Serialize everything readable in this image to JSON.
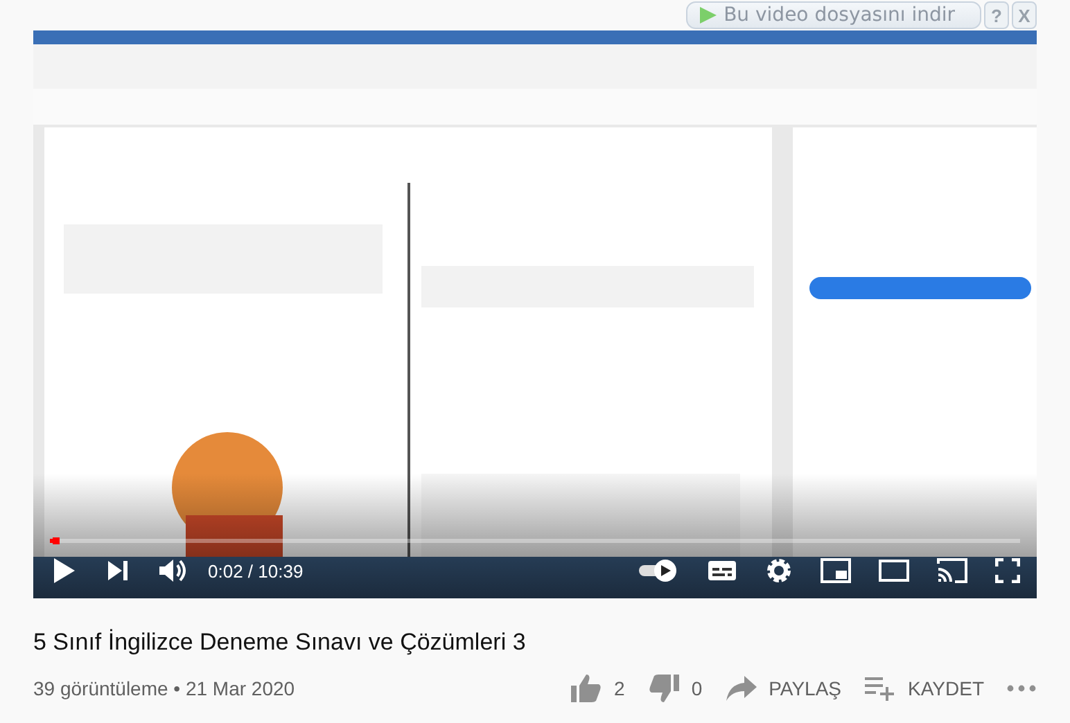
{
  "extension_bar": {
    "download_button": "Bu video dosyasını indir",
    "help": "?",
    "close": "X"
  },
  "player": {
    "progress": {
      "level": 0.003
    },
    "time": "0:02 / 10:39",
    "autoplay": true
  },
  "video": {
    "title": "5 Sınıf İngilizce Deneme Sınavı ve Çözümleri 3",
    "meta": "39 görüntüleme • 21 Mar 2020",
    "likes": "2",
    "dislikes": "0",
    "share": "PAYLAŞ",
    "save": "KAYDET"
  }
}
